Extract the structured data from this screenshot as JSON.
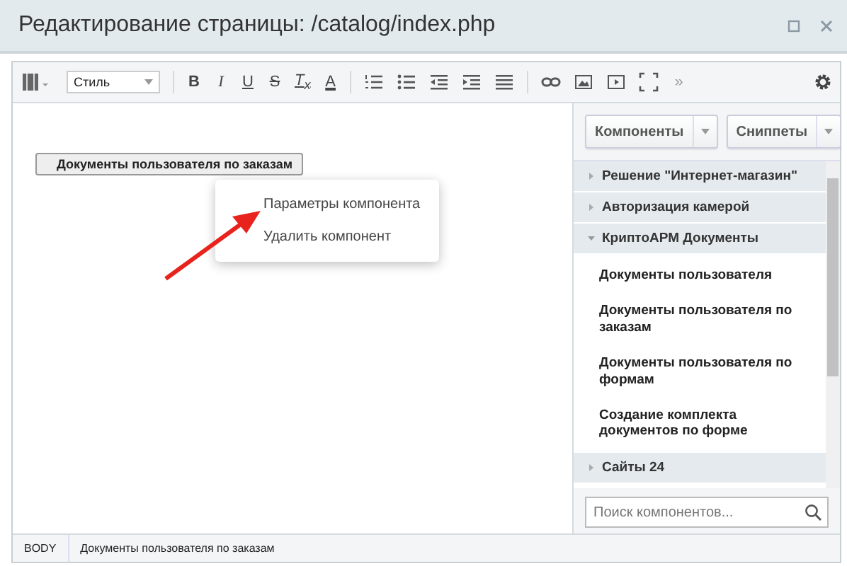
{
  "window": {
    "title": "Редактирование страницы: /catalog/index.php"
  },
  "toolbar": {
    "style_select": {
      "value": "Стиль"
    },
    "tools": [
      {
        "kind": "bold",
        "label": "B"
      },
      {
        "kind": "italic",
        "label": "I"
      },
      {
        "kind": "underline",
        "label": "U"
      },
      {
        "kind": "strike",
        "label": "S"
      },
      {
        "kind": "clear",
        "label": "T$_{x}$"
      },
      {
        "kind": "color",
        "label": "A"
      },
      {
        "kind": "sep"
      },
      {
        "kind": "ordered-list"
      },
      {
        "kind": "bullet-list"
      },
      {
        "kind": "outdent"
      },
      {
        "kind": "indent"
      },
      {
        "kind": "justify"
      },
      {
        "kind": "sep"
      },
      {
        "kind": "link"
      },
      {
        "kind": "image"
      },
      {
        "kind": "video"
      },
      {
        "kind": "fullscreen"
      },
      {
        "kind": "more",
        "label": "»"
      }
    ]
  },
  "editor": {
    "component": "Документы пользователя по заказам",
    "context_menu": [
      "Параметры компонента",
      "Удалить компонент"
    ]
  },
  "panel": {
    "buttons": [
      "Компоненты",
      "Сниппеты"
    ],
    "groups": [
      {
        "title": "Решение \"Интернет-магазин\"",
        "expanded": false
      },
      {
        "title": "Авторизация камерой",
        "expanded": false
      },
      {
        "title": "КриптоАРМ Документы",
        "expanded": true,
        "children": [
          "Документы пользователя",
          "Документы пользователя по заказам",
          "Документы пользователя по формам",
          "Создание комплекта документов по форме"
        ]
      },
      {
        "title": "Сайты 24",
        "expanded": false
      }
    ],
    "search": {
      "placeholder": "Поиск компонентов..."
    }
  },
  "status_bar": {
    "path": [
      "BODY",
      "Документы пользователя по заказам"
    ]
  }
}
